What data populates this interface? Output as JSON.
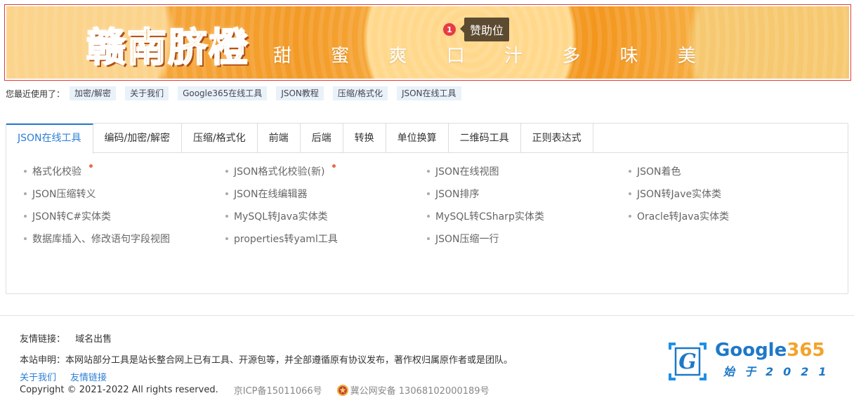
{
  "banner": {
    "title": "赣南脐橙",
    "slogan": "甜 蜜 爽 口   汁 多 味 美",
    "sponsor_badge": "1",
    "sponsor_label": "赞助位"
  },
  "recent": {
    "label": "您最近使用了：",
    "tags": [
      "加密/解密",
      "关于我们",
      "Google365在线工具",
      "JSON教程",
      "压缩/格式化",
      "JSON在线工具"
    ]
  },
  "tabs": [
    "JSON在线工具",
    "编码/加密/解密",
    "压缩/格式化",
    "前端",
    "后端",
    "转换",
    "单位换算",
    "二维码工具",
    "正则表达式"
  ],
  "active_tab": "JSON在线工具",
  "tools": [
    [
      {
        "label": "格式化校验",
        "hot": true
      },
      {
        "label": "JSON格式化校验(新)",
        "hot": true
      },
      {
        "label": "JSON在线视图",
        "hot": false
      },
      {
        "label": "JSON着色",
        "hot": false
      }
    ],
    [
      {
        "label": "JSON压缩转义",
        "hot": false
      },
      {
        "label": "JSON在线编辑器",
        "hot": false
      },
      {
        "label": "JSON排序",
        "hot": false
      },
      {
        "label": "JSON转Jave实体类",
        "hot": false
      }
    ],
    [
      {
        "label": "JSON转C#实体类",
        "hot": false
      },
      {
        "label": "MySQL转Java实体类",
        "hot": false
      },
      {
        "label": "MySQL转CSharp实体类",
        "hot": false
      },
      {
        "label": "Oracle转Java实体类",
        "hot": false
      }
    ],
    [
      {
        "label": "数据库插入、修改语句字段视图",
        "hot": false
      },
      {
        "label": "properties转yaml工具",
        "hot": false
      },
      {
        "label": "JSON压缩一行",
        "hot": false
      }
    ]
  ],
  "footer": {
    "friend_label": "友情链接：",
    "friend_link": "域名出售",
    "declaration": "本站申明：本网站部分工具是站长整合网上已有工具、开源包等，并全部遵循原有协议发布，著作权归属原作者或是团队。",
    "links": [
      "关于我们",
      "友情链接"
    ],
    "copyright": "Copyright © 2021-2022 All rights reserved.",
    "icp": "京ICP备15011066号",
    "police": "冀公网安备 13068102000189号"
  },
  "logo": {
    "name_main": "Google",
    "name_num": "365",
    "sub": "始于2021"
  },
  "colors": {
    "accent": "#2c7fd6",
    "hot_dot": "#e96b4f",
    "banner_border": "#e23b3b"
  }
}
